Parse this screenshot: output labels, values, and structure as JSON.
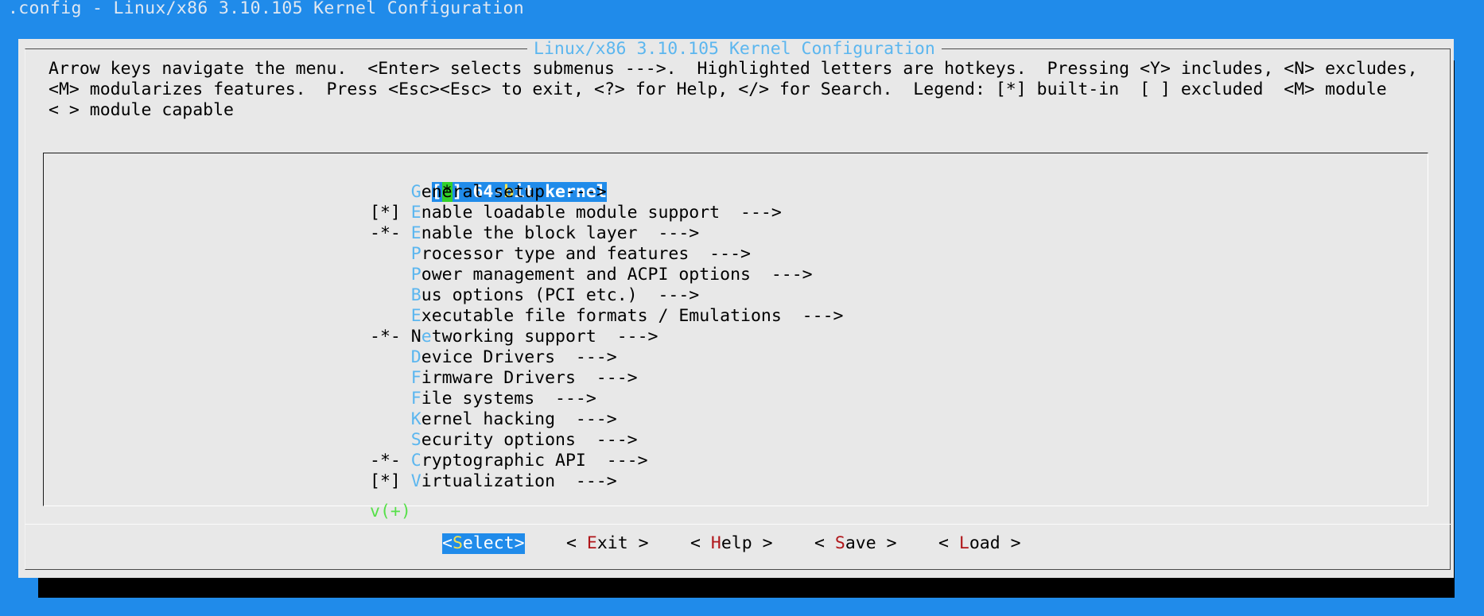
{
  "window": {
    "title": ".config - Linux/x86 3.10.105 Kernel Configuration"
  },
  "dialog": {
    "title": "Linux/x86 3.10.105 Kernel Configuration",
    "help_lines": [
      "Arrow keys navigate the menu.  <Enter> selects submenus --->.  Highlighted letters are hotkeys.  Pressing <Y> includes, <N> excludes,",
      "<M> modularizes features.  Press <Esc><Esc> to exit, <?> for Help, </> for Search.  Legend: [*] built-in  [ ] excluded  <M> module",
      "< > module capable"
    ]
  },
  "menu": {
    "items": [
      {
        "prefix": "[*]",
        "hotkey": "",
        "pre": "64-",
        "hot_mid": "b",
        "rest": "it kernel",
        "selected": true
      },
      {
        "prefix": "   ",
        "hotkey": "G",
        "rest": "eneral setup  --->"
      },
      {
        "prefix": "[*]",
        "hotkey": "E",
        "rest": "nable loadable module support  --->"
      },
      {
        "prefix": "-*-",
        "hotkey": "E",
        "rest": "nable the block layer  --->"
      },
      {
        "prefix": "   ",
        "hotkey": "P",
        "rest": "rocessor type and features  --->"
      },
      {
        "prefix": "   ",
        "hotkey": "P",
        "rest": "ower management and ACPI options  --->"
      },
      {
        "prefix": "   ",
        "hotkey": "B",
        "rest": "us options (PCI etc.)  --->"
      },
      {
        "prefix": "   ",
        "hotkey": "E",
        "rest": "xecutable file formats / Emulations  --->"
      },
      {
        "prefix": "-*-",
        "pre": "N",
        "hotkey": "e",
        "rest": "tworking support  --->"
      },
      {
        "prefix": "   ",
        "hotkey": "D",
        "rest": "evice Drivers  --->"
      },
      {
        "prefix": "   ",
        "hotkey": "F",
        "rest": "irmware Drivers  --->"
      },
      {
        "prefix": "   ",
        "hotkey": "F",
        "rest": "ile systems  --->"
      },
      {
        "prefix": "   ",
        "hotkey": "K",
        "rest": "ernel hacking  --->"
      },
      {
        "prefix": "   ",
        "hotkey": "S",
        "rest": "ecurity options  --->"
      },
      {
        "prefix": "-*-",
        "hotkey": "C",
        "rest": "ryptographic API  --->"
      },
      {
        "prefix": "[*]",
        "hotkey": "V",
        "rest": "irtualization  --->"
      }
    ],
    "more_indicator": "v(+)"
  },
  "buttons": [
    {
      "open": "<",
      "hotkey": "S",
      "rest": "elect",
      "close": ">",
      "active": true
    },
    {
      "open": "< ",
      "hotkey": "E",
      "rest": "xit",
      "close": " >",
      "active": false
    },
    {
      "open": "< ",
      "hotkey": "H",
      "rest": "elp",
      "close": " >",
      "active": false
    },
    {
      "open": "< ",
      "hotkey": "S",
      "rest": "ave",
      "close": " >",
      "active": false
    },
    {
      "open": "< ",
      "hotkey": "L",
      "rest": "oad",
      "close": " >",
      "active": false
    }
  ],
  "colors": {
    "background": "#208bea",
    "dialog": "#e8e8e8",
    "hotkey": "#5bb6ef",
    "button_hotkey": "#b0161a",
    "selection": "#208bea",
    "selected_hotkey": "#f6e34c",
    "more_indicator": "#57e04a"
  }
}
